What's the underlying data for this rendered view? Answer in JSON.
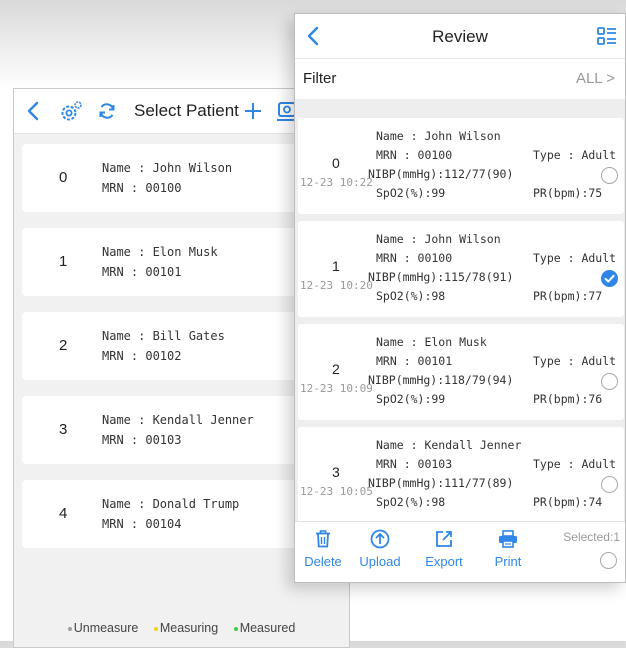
{
  "select_patient": {
    "title": "Select Patient",
    "patients": [
      {
        "index": "0",
        "name": "Name : John Wilson",
        "mrn": "MRN : 00100"
      },
      {
        "index": "1",
        "name": "Name : Elon Musk",
        "mrn": "MRN : 00101"
      },
      {
        "index": "2",
        "name": "Name : Bill Gates",
        "mrn": "MRN : 00102"
      },
      {
        "index": "3",
        "name": "Name : Kendall Jenner",
        "mrn": "MRN : 00103"
      },
      {
        "index": "4",
        "name": "Name : Donald Trump",
        "mrn": "MRN : 00104"
      }
    ],
    "legend": [
      {
        "label": "Unmeasure",
        "color": "#9e9e9e"
      },
      {
        "label": "Measuring",
        "color": "#f2d21b"
      },
      {
        "label": "Measured",
        "color": "#3cc94a"
      }
    ]
  },
  "review": {
    "title": "Review",
    "filter_label": "Filter",
    "filter_value": "ALL >",
    "records": [
      {
        "index": "0",
        "time": "12-23 10:22",
        "name": "Name : John Wilson",
        "mrn": "MRN : 00100",
        "type": "Type : Adult",
        "nibp": "NIBP(mmHg):112/77(90)",
        "spo2": "SpO2(%):99",
        "pr": "PR(bpm):75",
        "selected": false
      },
      {
        "index": "1",
        "time": "12-23 10:20",
        "name": "Name : John Wilson",
        "mrn": "MRN : 00100",
        "type": "Type : Adult",
        "nibp": "NIBP(mmHg):115/78(91)",
        "spo2": "SpO2(%):98",
        "pr": "PR(bpm):77",
        "selected": true
      },
      {
        "index": "2",
        "time": "12-23 10:09",
        "name": "Name : Elon Musk",
        "mrn": "MRN : 00101",
        "type": "Type : Adult",
        "nibp": "NIBP(mmHg):118/79(94)",
        "spo2": "SpO2(%):99",
        "pr": "PR(bpm):76",
        "selected": false
      },
      {
        "index": "3",
        "time": "12-23 10:05",
        "name": "Name : Kendall Jenner",
        "mrn": "MRN : 00103",
        "type": "Type : Adult",
        "nibp": "NIBP(mmHg):111/77(89)",
        "spo2": "SpO2(%):98",
        "pr": "PR(bpm):74",
        "selected": false
      }
    ],
    "toolbar": {
      "delete": "Delete",
      "upload": "Upload",
      "export": "Export",
      "print": "Print",
      "selected": "Selected:1"
    }
  },
  "colors": {
    "accent": "#2f86e6"
  }
}
